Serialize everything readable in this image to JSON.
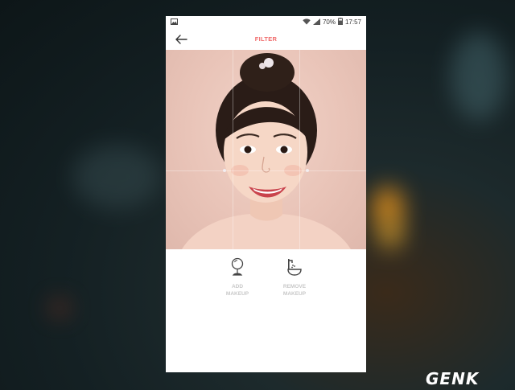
{
  "status_bar": {
    "battery": "70%",
    "time": "17:57",
    "icons": [
      "image-icon",
      "wifi-icon",
      "signal-icon",
      "battery-icon"
    ]
  },
  "app_bar": {
    "title": "FILTER",
    "back_icon": "arrow-left-icon",
    "title_color": "#f06a6a"
  },
  "photo": {
    "subject": "portrait photo of smiling woman"
  },
  "actions": [
    {
      "label": "ADD\nMAKEUP",
      "icon": "mirror-icon"
    },
    {
      "label": "REMOVE\nMAKEUP",
      "icon": "sink-icon"
    }
  ],
  "watermark": {
    "text": "GENK"
  }
}
